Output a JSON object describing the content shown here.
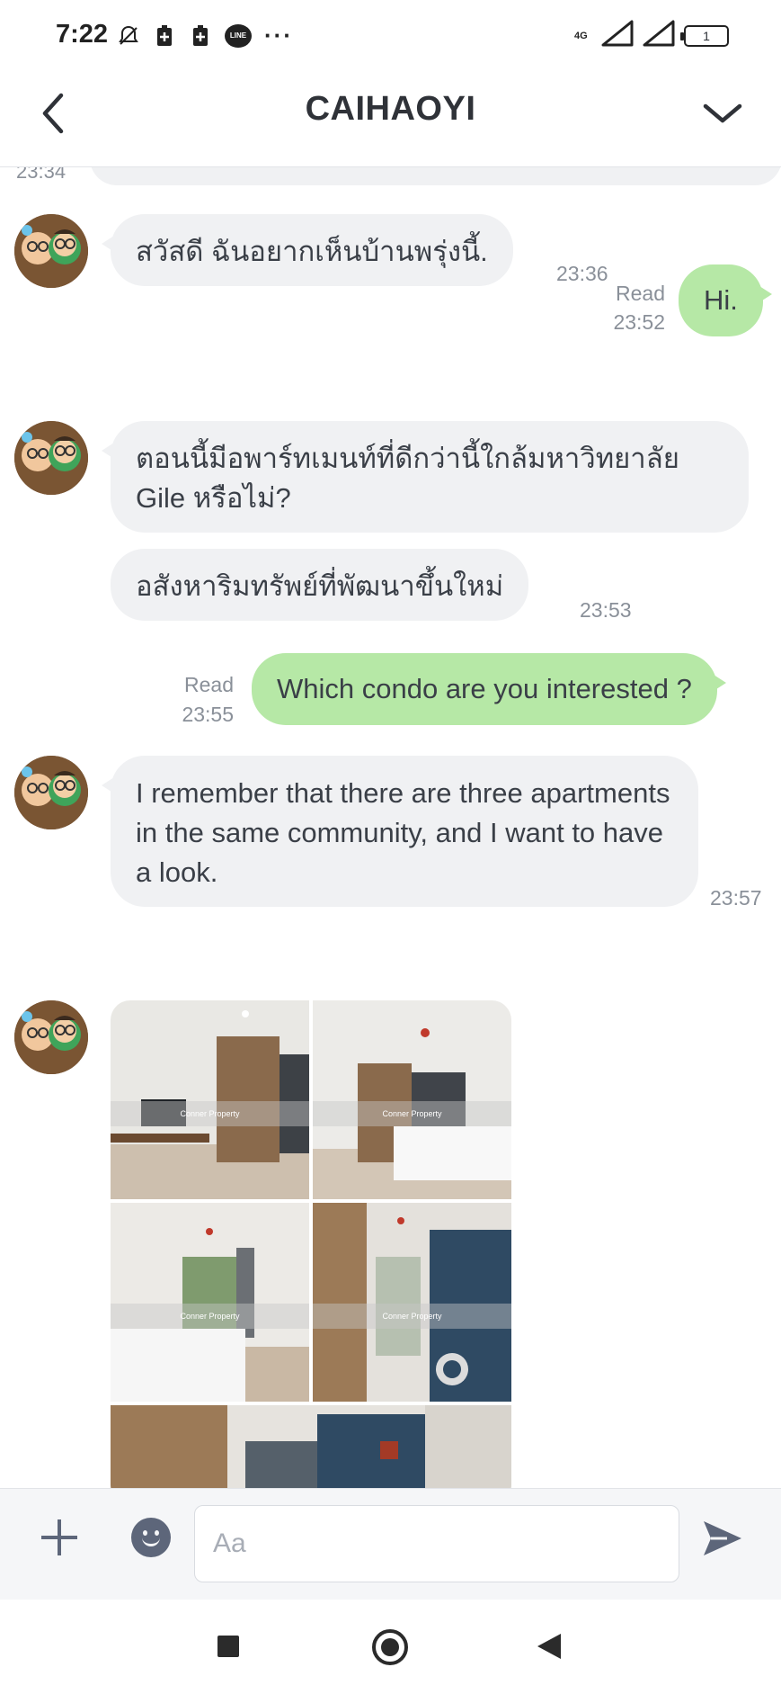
{
  "status_bar": {
    "time": "7:22",
    "network": "4G",
    "battery": "1",
    "icons": [
      "mute-bell-icon",
      "battery-saver-icon",
      "battery-saver-icon",
      "line-app-icon",
      "more-dots-icon",
      "signal-icon",
      "signal-icon",
      "battery-icon"
    ]
  },
  "header": {
    "title": "CAIHAOYI",
    "back_icon": "chevron-left-icon",
    "menu_icon": "chevron-down-icon"
  },
  "messages": {
    "prev_time": "23:34",
    "m1": {
      "text": "สวัสดี ฉันอยากเห็นบ้านพรุ่งนี้.",
      "time": "23:36"
    },
    "m2": {
      "text": "Hi.",
      "read": "Read",
      "time": "23:52"
    },
    "m3": {
      "text": "ตอนนี้มีอพาร์ทเมนท์ที่ดีกว่านี้ใกล้มหาวิทยาลัย Gile หรือไม่?"
    },
    "m4": {
      "text": "อสังหาริมทรัพย์ที่พัฒนาขึ้นใหม่",
      "time": "23:53"
    },
    "m5": {
      "text": "Which condo are you interested ?",
      "read": "Read",
      "time": "23:55"
    },
    "m6": {
      "text": "I remember that there are three apartments in the same community, and I want to have a look.",
      "time": "23:57"
    },
    "photos": {
      "watermark": "Conner Property",
      "count_visible": 5
    }
  },
  "input_bar": {
    "placeholder": "Aa",
    "plus_icon": "plus-icon",
    "emoji_icon": "emoji-icon",
    "send_icon": "send-icon"
  },
  "colors": {
    "incoming_bubble": "#f0f1f3",
    "outgoing_bubble": "#b6e8a6",
    "timestamp": "#8a9099"
  }
}
